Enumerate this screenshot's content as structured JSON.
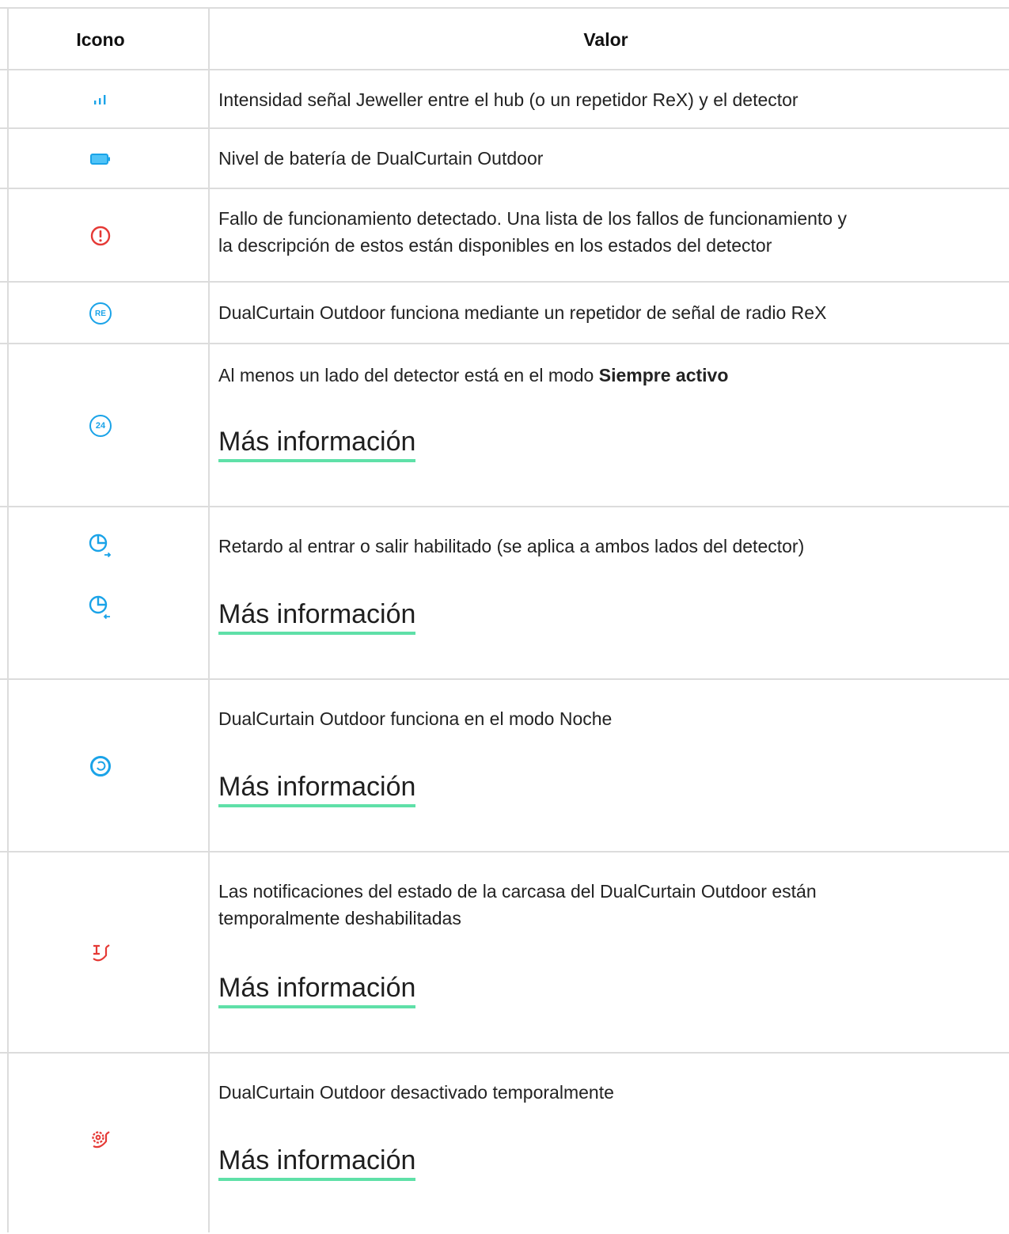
{
  "header": {
    "icon_col": "Icono",
    "value_col": "Valor"
  },
  "rows": [
    {
      "icon": "signal-strength-icon",
      "text": "Intensidad señal Jeweller entre el hub (o un repetidor ReX) y el detector"
    },
    {
      "icon": "battery-icon",
      "text": "Nivel de batería de DualCurtain Outdoor"
    },
    {
      "icon": "malfunction-icon",
      "line1": "Fallo de funcionamiento detectado. Una lista de los fallos de funcionamiento y",
      "line2": "la descripción de estos están disponibles en los estados del detector"
    },
    {
      "icon": "rex-repeater-icon",
      "icon_text": "RE",
      "text": "DualCurtain Outdoor funciona mediante un repetidor de señal de radio ReX"
    },
    {
      "icon": "always-active-icon",
      "icon_text": "24",
      "text_pre": "Al menos un lado del detector está en el modo ",
      "text_bold": "Siempre activo",
      "link": "Más información"
    },
    {
      "icons": [
        "entry-delay-icon",
        "exit-delay-icon"
      ],
      "text": "Retardo al entrar o salir habilitado (se aplica a ambos lados del detector)",
      "link": "Más información"
    },
    {
      "icon": "night-mode-icon",
      "text": "DualCurtain Outdoor funciona en el modo Noche",
      "link": "Más información"
    },
    {
      "icon": "lid-notifications-off-icon",
      "line1": "Las notificaciones del estado de la carcasa del DualCurtain Outdoor están",
      "line2": "temporalmente deshabilitadas",
      "link": "Más información"
    },
    {
      "icon": "device-disabled-icon",
      "text": "DualCurtain Outdoor desactivado temporalmente",
      "link": "Más información"
    }
  ],
  "colors": {
    "accent_blue": "#1aa3e8",
    "alert_red": "#e53935",
    "link_underline": "#5fe0a8",
    "border": "#dcdcdc"
  }
}
